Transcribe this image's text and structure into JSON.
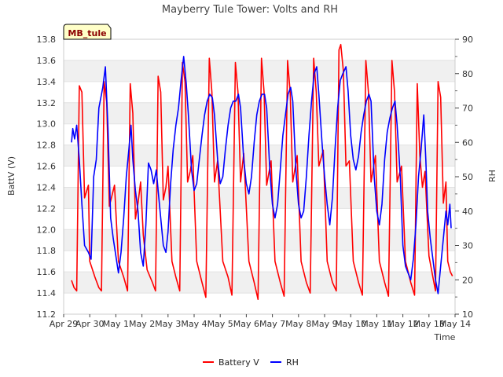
{
  "chart_data": {
    "type": "line",
    "title": "Mayberry Tule Tower: Volts and RH",
    "xlabel": "Time",
    "ylabel_left": "BattV (V)",
    "ylabel_right": "RH",
    "badge": "MB_tule",
    "x_tick_labels": [
      "Apr 29",
      "Apr 30",
      "May 1",
      "May 2",
      "May 3",
      "May 4",
      "May 5",
      "May 6",
      "May 7",
      "May 8",
      "May 9",
      "May 10",
      "May 11",
      "May 12",
      "May 13",
      "May 14"
    ],
    "xlim_days": [
      0,
      15
    ],
    "ylim_left": [
      11.2,
      13.8
    ],
    "yticks_left": [
      "11.2",
      "11.4",
      "11.6",
      "11.8",
      "12.0",
      "12.2",
      "12.4",
      "12.6",
      "12.8",
      "13.0",
      "13.2",
      "13.4",
      "13.6",
      "13.8"
    ],
    "ylim_right": [
      10,
      90
    ],
    "yticks_right": [
      "10",
      "20",
      "30",
      "40",
      "50",
      "60",
      "70",
      "80",
      "90"
    ],
    "grid": "horizontal-bands",
    "legend_position": "bottom-center",
    "series": [
      {
        "name": "Battery V",
        "axis": "left",
        "color": "#ff0000",
        "points": [
          [
            0.3,
            11.52
          ],
          [
            0.4,
            11.45
          ],
          [
            0.5,
            11.42
          ],
          [
            0.6,
            13.36
          ],
          [
            0.7,
            13.3
          ],
          [
            0.8,
            12.3
          ],
          [
            0.95,
            12.42
          ],
          [
            1.0,
            11.7
          ],
          [
            1.2,
            11.55
          ],
          [
            1.35,
            11.45
          ],
          [
            1.45,
            11.42
          ],
          [
            1.55,
            13.4
          ],
          [
            1.65,
            13.2
          ],
          [
            1.75,
            12.22
          ],
          [
            1.95,
            12.42
          ],
          [
            2.1,
            11.7
          ],
          [
            2.3,
            11.55
          ],
          [
            2.45,
            11.42
          ],
          [
            2.55,
            13.38
          ],
          [
            2.65,
            13.1
          ],
          [
            2.75,
            12.1
          ],
          [
            2.85,
            12.25
          ],
          [
            2.95,
            12.45
          ],
          [
            3.05,
            11.95
          ],
          [
            3.2,
            11.62
          ],
          [
            3.4,
            11.5
          ],
          [
            3.52,
            11.42
          ],
          [
            3.62,
            13.45
          ],
          [
            3.72,
            13.3
          ],
          [
            3.82,
            12.28
          ],
          [
            3.92,
            12.4
          ],
          [
            4.0,
            12.6
          ],
          [
            4.15,
            11.7
          ],
          [
            4.3,
            11.55
          ],
          [
            4.45,
            11.42
          ],
          [
            4.55,
            13.58
          ],
          [
            4.65,
            13.4
          ],
          [
            4.75,
            12.45
          ],
          [
            4.85,
            12.55
          ],
          [
            4.95,
            12.7
          ],
          [
            5.1,
            11.7
          ],
          [
            5.3,
            11.5
          ],
          [
            5.45,
            11.36
          ],
          [
            5.58,
            13.62
          ],
          [
            5.68,
            13.3
          ],
          [
            5.78,
            12.45
          ],
          [
            5.9,
            12.65
          ],
          [
            6.1,
            11.7
          ],
          [
            6.3,
            11.55
          ],
          [
            6.45,
            11.38
          ],
          [
            6.58,
            13.58
          ],
          [
            6.68,
            13.3
          ],
          [
            6.78,
            12.45
          ],
          [
            6.9,
            12.72
          ],
          [
            7.1,
            11.7
          ],
          [
            7.3,
            11.5
          ],
          [
            7.45,
            11.34
          ],
          [
            7.58,
            13.62
          ],
          [
            7.68,
            13.3
          ],
          [
            7.78,
            12.42
          ],
          [
            7.95,
            12.65
          ],
          [
            8.1,
            11.7
          ],
          [
            8.3,
            11.5
          ],
          [
            8.45,
            11.37
          ],
          [
            8.58,
            13.6
          ],
          [
            8.68,
            13.3
          ],
          [
            8.78,
            12.45
          ],
          [
            8.95,
            12.7
          ],
          [
            9.1,
            11.7
          ],
          [
            9.3,
            11.5
          ],
          [
            9.45,
            11.4
          ],
          [
            9.58,
            13.62
          ],
          [
            9.68,
            13.3
          ],
          [
            9.78,
            12.6
          ],
          [
            9.95,
            12.75
          ],
          [
            10.1,
            11.7
          ],
          [
            10.3,
            11.5
          ],
          [
            10.45,
            11.42
          ],
          [
            10.55,
            13.7
          ],
          [
            10.62,
            13.75
          ],
          [
            10.72,
            13.5
          ],
          [
            10.82,
            12.6
          ],
          [
            10.95,
            12.65
          ],
          [
            11.1,
            11.7
          ],
          [
            11.3,
            11.5
          ],
          [
            11.45,
            11.38
          ],
          [
            11.58,
            13.6
          ],
          [
            11.68,
            13.3
          ],
          [
            11.78,
            12.45
          ],
          [
            11.95,
            12.7
          ],
          [
            12.1,
            11.7
          ],
          [
            12.3,
            11.5
          ],
          [
            12.45,
            11.37
          ],
          [
            12.58,
            13.6
          ],
          [
            12.68,
            13.3
          ],
          [
            12.78,
            12.45
          ],
          [
            12.95,
            12.6
          ],
          [
            13.1,
            11.7
          ],
          [
            13.3,
            11.5
          ],
          [
            13.45,
            11.38
          ],
          [
            13.55,
            13.38
          ],
          [
            13.65,
            12.7
          ],
          [
            13.75,
            12.4
          ],
          [
            13.85,
            12.55
          ],
          [
            14.0,
            11.75
          ],
          [
            14.15,
            11.55
          ],
          [
            14.25,
            11.42
          ],
          [
            14.35,
            13.4
          ],
          [
            14.45,
            13.25
          ],
          [
            14.55,
            12.25
          ],
          [
            14.65,
            12.45
          ],
          [
            14.72,
            11.7
          ],
          [
            14.82,
            11.6
          ],
          [
            14.9,
            11.56
          ]
        ]
      },
      {
        "name": "RH",
        "axis": "right",
        "color": "#0000ff",
        "points": [
          [
            0.3,
            60
          ],
          [
            0.35,
            64
          ],
          [
            0.42,
            61
          ],
          [
            0.5,
            65
          ],
          [
            0.6,
            55
          ],
          [
            0.7,
            42
          ],
          [
            0.8,
            30
          ],
          [
            0.95,
            28
          ],
          [
            1.05,
            26
          ],
          [
            1.15,
            50
          ],
          [
            1.25,
            55
          ],
          [
            1.35,
            70
          ],
          [
            1.5,
            76
          ],
          [
            1.6,
            82
          ],
          [
            1.7,
            64
          ],
          [
            1.8,
            38
          ],
          [
            1.9,
            32
          ],
          [
            2.0,
            27
          ],
          [
            2.1,
            22
          ],
          [
            2.2,
            28
          ],
          [
            2.3,
            38
          ],
          [
            2.4,
            50
          ],
          [
            2.5,
            58
          ],
          [
            2.58,
            65
          ],
          [
            2.65,
            55
          ],
          [
            2.75,
            46
          ],
          [
            2.85,
            40
          ],
          [
            2.95,
            28
          ],
          [
            3.05,
            24
          ],
          [
            3.15,
            36
          ],
          [
            3.25,
            54
          ],
          [
            3.35,
            52
          ],
          [
            3.45,
            48
          ],
          [
            3.55,
            52
          ],
          [
            3.62,
            46
          ],
          [
            3.72,
            38
          ],
          [
            3.82,
            30
          ],
          [
            3.92,
            28
          ],
          [
            4.0,
            34
          ],
          [
            4.1,
            48
          ],
          [
            4.2,
            58
          ],
          [
            4.3,
            65
          ],
          [
            4.4,
            70
          ],
          [
            4.5,
            78
          ],
          [
            4.6,
            85
          ],
          [
            4.7,
            77
          ],
          [
            4.78,
            68
          ],
          [
            4.9,
            52
          ],
          [
            5.0,
            46
          ],
          [
            5.1,
            48
          ],
          [
            5.2,
            55
          ],
          [
            5.3,
            62
          ],
          [
            5.4,
            68
          ],
          [
            5.5,
            72
          ],
          [
            5.6,
            74
          ],
          [
            5.7,
            73
          ],
          [
            5.78,
            68
          ],
          [
            5.9,
            55
          ],
          [
            6.0,
            48
          ],
          [
            6.1,
            50
          ],
          [
            6.2,
            58
          ],
          [
            6.3,
            65
          ],
          [
            6.4,
            70
          ],
          [
            6.5,
            72
          ],
          [
            6.6,
            72
          ],
          [
            6.7,
            74
          ],
          [
            6.78,
            70
          ],
          [
            6.9,
            55
          ],
          [
            7.0,
            48
          ],
          [
            7.1,
            45
          ],
          [
            7.2,
            50
          ],
          [
            7.3,
            60
          ],
          [
            7.4,
            68
          ],
          [
            7.5,
            72
          ],
          [
            7.6,
            74
          ],
          [
            7.7,
            74
          ],
          [
            7.78,
            70
          ],
          [
            7.9,
            52
          ],
          [
            8.0,
            42
          ],
          [
            8.1,
            38
          ],
          [
            8.2,
            42
          ],
          [
            8.3,
            52
          ],
          [
            8.4,
            62
          ],
          [
            8.5,
            68
          ],
          [
            8.6,
            74
          ],
          [
            8.7,
            76
          ],
          [
            8.78,
            72
          ],
          [
            8.9,
            52
          ],
          [
            9.0,
            42
          ],
          [
            9.1,
            38
          ],
          [
            9.2,
            40
          ],
          [
            9.3,
            50
          ],
          [
            9.4,
            62
          ],
          [
            9.5,
            72
          ],
          [
            9.6,
            80
          ],
          [
            9.7,
            82
          ],
          [
            9.78,
            74
          ],
          [
            9.9,
            60
          ],
          [
            10.0,
            50
          ],
          [
            10.1,
            42
          ],
          [
            10.2,
            36
          ],
          [
            10.3,
            44
          ],
          [
            10.4,
            58
          ],
          [
            10.5,
            70
          ],
          [
            10.6,
            78
          ],
          [
            10.7,
            80
          ],
          [
            10.82,
            82
          ],
          [
            10.9,
            75
          ],
          [
            11.0,
            62
          ],
          [
            11.1,
            55
          ],
          [
            11.2,
            52
          ],
          [
            11.3,
            56
          ],
          [
            11.4,
            63
          ],
          [
            11.5,
            68
          ],
          [
            11.6,
            72
          ],
          [
            11.7,
            74
          ],
          [
            11.78,
            72
          ],
          [
            11.9,
            50
          ],
          [
            12.0,
            40
          ],
          [
            12.1,
            36
          ],
          [
            12.2,
            42
          ],
          [
            12.3,
            55
          ],
          [
            12.4,
            63
          ],
          [
            12.5,
            67
          ],
          [
            12.6,
            70
          ],
          [
            12.7,
            72
          ],
          [
            12.78,
            65
          ],
          [
            12.9,
            50
          ],
          [
            13.0,
            30
          ],
          [
            13.1,
            24
          ],
          [
            13.2,
            22
          ],
          [
            13.3,
            20
          ],
          [
            13.4,
            26
          ],
          [
            13.5,
            36
          ],
          [
            13.6,
            50
          ],
          [
            13.7,
            58
          ],
          [
            13.8,
            68
          ],
          [
            13.88,
            55
          ],
          [
            13.95,
            40
          ],
          [
            14.05,
            32
          ],
          [
            14.15,
            26
          ],
          [
            14.25,
            20
          ],
          [
            14.35,
            16
          ],
          [
            14.45,
            24
          ],
          [
            14.55,
            32
          ],
          [
            14.65,
            40
          ],
          [
            14.72,
            36
          ],
          [
            14.8,
            42
          ],
          [
            14.85,
            35
          ]
        ]
      }
    ]
  }
}
